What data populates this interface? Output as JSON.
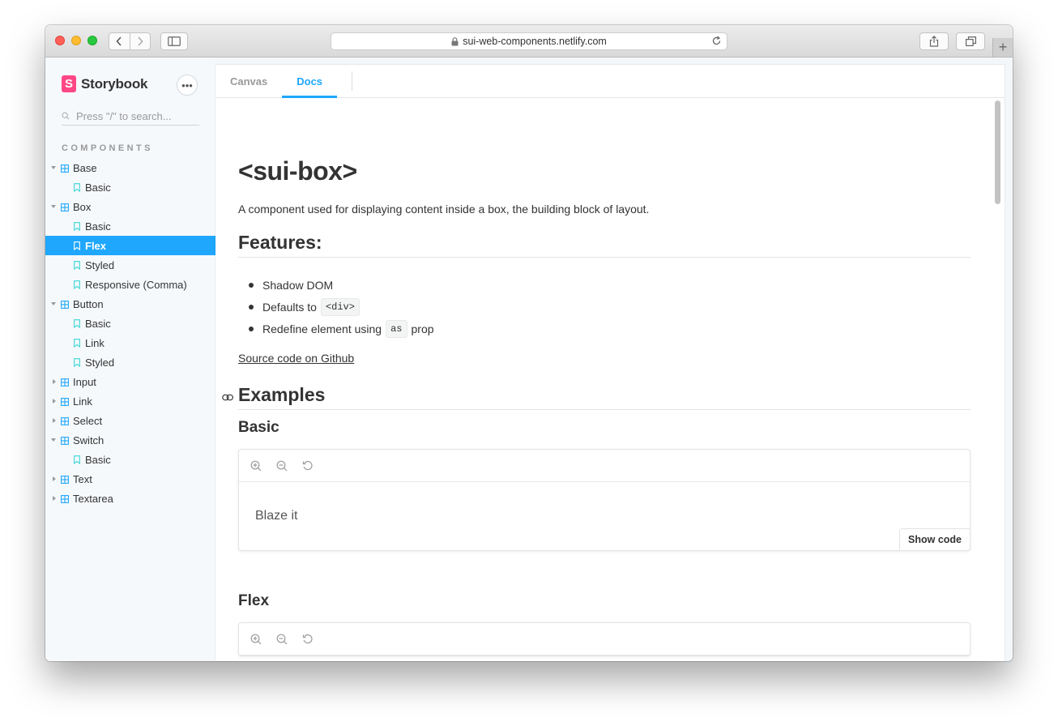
{
  "browser": {
    "url": "sui-web-components.netlify.com",
    "icons": {
      "back": "chevron-left-icon",
      "forward": "chevron-right-icon",
      "sidebar": "sidebar-toggle-icon",
      "lock": "lock-icon",
      "reload": "reload-icon",
      "share": "share-icon",
      "tabs": "tabs-overview-icon",
      "new_tab": "plus-icon"
    },
    "new_tab_label": "+"
  },
  "sidebar": {
    "brand": "Storybook",
    "brand_logo_letter": "S",
    "menu_label": "•••",
    "search_placeholder": "Press \"/\" to search...",
    "section_title": "COMPONENTS",
    "tree": [
      {
        "type": "component",
        "label": "Base",
        "expanded": true
      },
      {
        "type": "story",
        "label": "Basic"
      },
      {
        "type": "component",
        "label": "Box",
        "expanded": true
      },
      {
        "type": "story",
        "label": "Basic"
      },
      {
        "type": "story",
        "label": "Flex",
        "active": true
      },
      {
        "type": "story",
        "label": "Styled"
      },
      {
        "type": "story",
        "label": "Responsive (Comma)"
      },
      {
        "type": "component",
        "label": "Button",
        "expanded": true
      },
      {
        "type": "story",
        "label": "Basic"
      },
      {
        "type": "story",
        "label": "Link"
      },
      {
        "type": "story",
        "label": "Styled"
      },
      {
        "type": "component",
        "label": "Input",
        "expanded": false
      },
      {
        "type": "component",
        "label": "Link",
        "expanded": false
      },
      {
        "type": "component",
        "label": "Select",
        "expanded": false
      },
      {
        "type": "component",
        "label": "Switch",
        "expanded": true
      },
      {
        "type": "story",
        "label": "Basic"
      },
      {
        "type": "component",
        "label": "Text",
        "expanded": false
      },
      {
        "type": "component",
        "label": "Textarea",
        "expanded": false
      }
    ]
  },
  "tabs": [
    {
      "label": "Canvas",
      "active": false
    },
    {
      "label": "Docs",
      "active": true
    }
  ],
  "doc": {
    "title": "<sui-box>",
    "intro": "A component used for displaying content inside a box, the building block of layout.",
    "features_heading": "Features:",
    "features": {
      "item1": "Shadow DOM",
      "item2_prefix": "Defaults to",
      "item2_code": "<div>",
      "item3_prefix": "Redefine element using",
      "item3_code": "as",
      "item3_suffix": "prop"
    },
    "source_link": "Source code on Github",
    "examples_heading": "Examples",
    "basic_heading": "Basic",
    "basic_preview_text": "Blaze it",
    "show_code": "Show code",
    "flex_heading": "Flex"
  },
  "colors": {
    "accent": "#1ea7fd",
    "brand": "#ff4785",
    "sidebar_bg": "#f6f9fc",
    "story_icon": "#37d5d3",
    "component_icon": "#1ea7fd"
  }
}
